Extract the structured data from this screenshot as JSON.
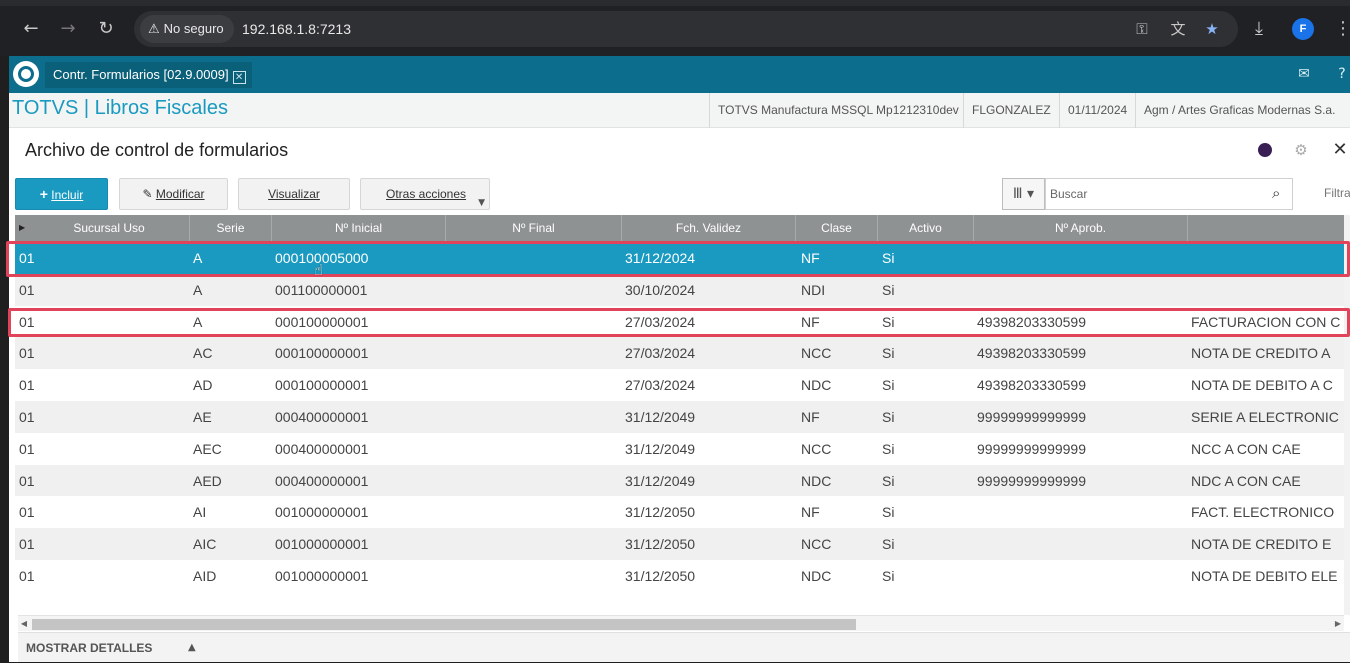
{
  "browser": {
    "security_label": "No seguro",
    "url": "192.168.1.8:7213",
    "profile_initial": "F"
  },
  "app": {
    "tab_label": "Contr. Formularios [02.9.0009]",
    "module_title": "TOTVS | Libros Fiscales",
    "environment": "TOTVS Manufactura MSSQL Mp1212310dev",
    "user": "FLGONZALEZ",
    "date": "01/11/2024",
    "company": "Agm / Artes Graficas Modernas S.a."
  },
  "page": {
    "title": "Archivo de control de formularios"
  },
  "toolbar": {
    "include_plus": "+",
    "include_label": "Incluir",
    "modify_label": "Modificar",
    "view_label": "Visualizar",
    "other_label": "Otras acciones",
    "search_placeholder": "Buscar",
    "filter_label": "Filtra"
  },
  "grid": {
    "columns": [
      "Sucursal Uso",
      "Serie",
      "Nº Inicial",
      "Nº Final",
      "Fch. Validez",
      "Clase",
      "Activo",
      "Nº Aprob.",
      ""
    ],
    "rows": [
      {
        "sucursal": "01",
        "serie": "A",
        "inicial": "000100005000",
        "final": "",
        "validez": "31/12/2024",
        "clase": "NF",
        "activo": "Si",
        "aprob": "",
        "desc": ""
      },
      {
        "sucursal": "01",
        "serie": "A",
        "inicial": "001100000001",
        "final": "",
        "validez": "30/10/2024",
        "clase": "NDI",
        "activo": "Si",
        "aprob": "",
        "desc": ""
      },
      {
        "sucursal": "01",
        "serie": "A",
        "inicial": "000100000001",
        "final": "",
        "validez": "27/03/2024",
        "clase": "NF",
        "activo": "Si",
        "aprob": "49398203330599",
        "desc": "FACTURACION CON C"
      },
      {
        "sucursal": "01",
        "serie": "AC",
        "inicial": "000100000001",
        "final": "",
        "validez": "27/03/2024",
        "clase": "NCC",
        "activo": "Si",
        "aprob": "49398203330599",
        "desc": "NOTA DE CREDITO A"
      },
      {
        "sucursal": "01",
        "serie": "AD",
        "inicial": "000100000001",
        "final": "",
        "validez": "27/03/2024",
        "clase": "NDC",
        "activo": "Si",
        "aprob": "49398203330599",
        "desc": "NOTA DE DEBITO A C"
      },
      {
        "sucursal": "01",
        "serie": "AE",
        "inicial": "000400000001",
        "final": "",
        "validez": "31/12/2049",
        "clase": "NF",
        "activo": "Si",
        "aprob": "99999999999999",
        "desc": "SERIE A ELECTRONIC"
      },
      {
        "sucursal": "01",
        "serie": "AEC",
        "inicial": "000400000001",
        "final": "",
        "validez": "31/12/2049",
        "clase": "NCC",
        "activo": "Si",
        "aprob": "99999999999999",
        "desc": "NCC A CON CAE"
      },
      {
        "sucursal": "01",
        "serie": "AED",
        "inicial": "000400000001",
        "final": "",
        "validez": "31/12/2049",
        "clase": "NDC",
        "activo": "Si",
        "aprob": "99999999999999",
        "desc": "NDC A CON CAE"
      },
      {
        "sucursal": "01",
        "serie": "AI",
        "inicial": "001000000001",
        "final": "",
        "validez": "31/12/2050",
        "clase": "NF",
        "activo": "Si",
        "aprob": "",
        "desc": "FACT. ELECTRONICO"
      },
      {
        "sucursal": "01",
        "serie": "AIC",
        "inicial": "001000000001",
        "final": "",
        "validez": "31/12/2050",
        "clase": "NCC",
        "activo": "Si",
        "aprob": "",
        "desc": "NOTA DE CREDITO E"
      },
      {
        "sucursal": "01",
        "serie": "AID",
        "inicial": "001000000001",
        "final": "",
        "validez": "31/12/2050",
        "clase": "NDC",
        "activo": "Si",
        "aprob": "",
        "desc": "NOTA DE DEBITO ELE"
      }
    ]
  },
  "footer": {
    "details_label": "MOSTRAR DETALLES"
  },
  "colors": {
    "accent": "#1a9ac0",
    "appbar": "#0c6e8c",
    "highlight_box": "#e0435a"
  }
}
